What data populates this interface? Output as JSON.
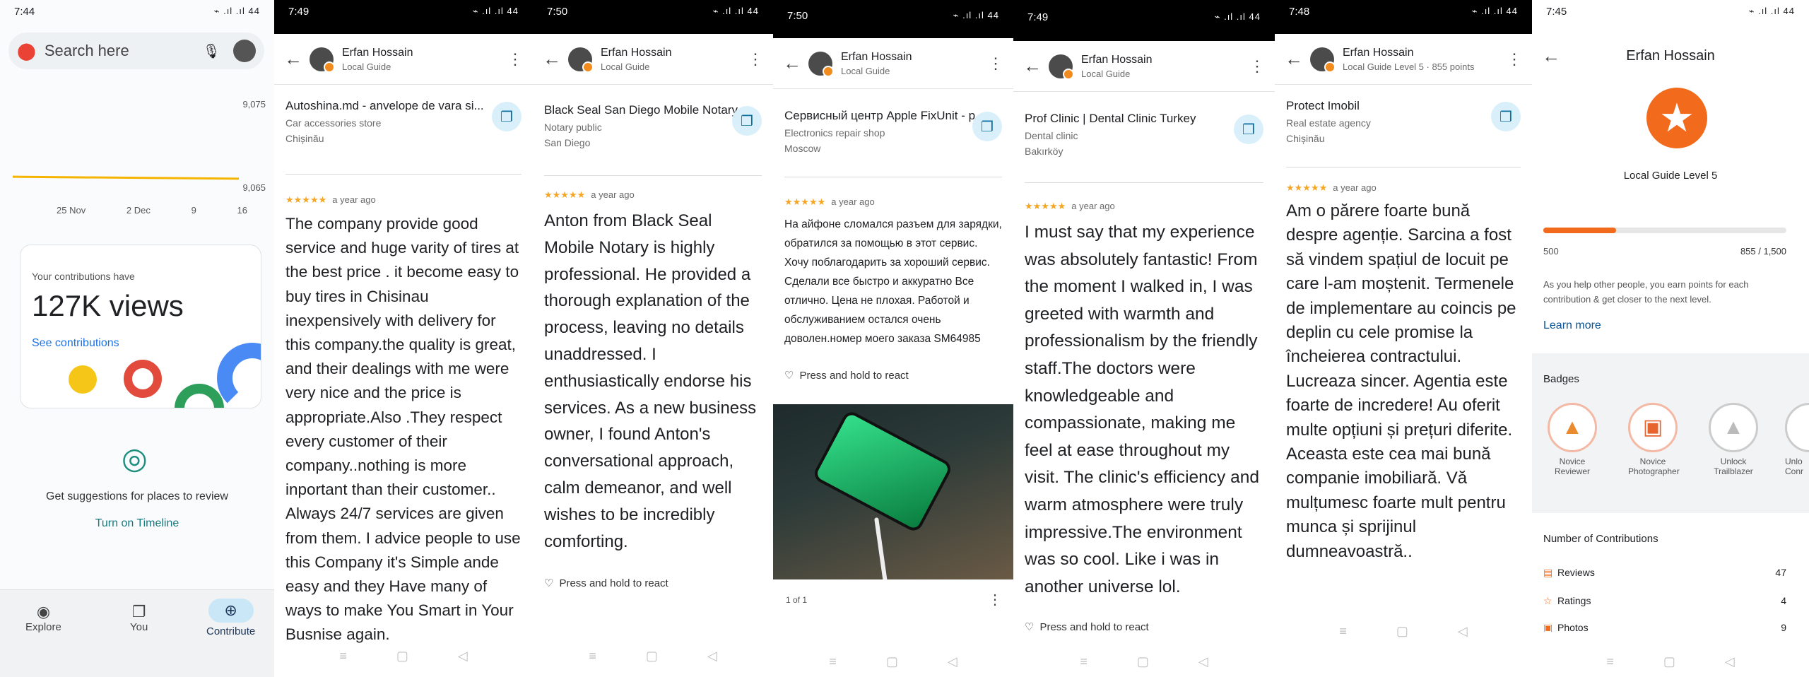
{
  "p1": {
    "time": "7:44",
    "signal": "⌁ .ıl .ıl 44",
    "search_placeholder": "Search here",
    "top_val": "9,075",
    "bottom_val": "9,065",
    "xticks": [
      "25 Nov",
      "2 Dec",
      "9",
      "16"
    ],
    "contrib_label": "Your contributions have",
    "views": "127K views",
    "see_contrib": "See contributions",
    "suggest": "Get suggestions for places to review",
    "timeline": "Turn on Timeline",
    "nav": [
      "Explore",
      "You",
      "Contribute"
    ]
  },
  "p2": {
    "time": "7:49",
    "name": "Erfan Hossain",
    "sub": "Local Guide",
    "place": "Autoshina.md - anvelope de vara si...",
    "cat": "Car accessories store",
    "city": "Chișinău",
    "ago": "a year ago",
    "review": "The company provide good service and huge varity of tires at the best price . it become easy to buy tires in Chisinau inexpensively with delivery for this company.the quality is great, and their dealings with me were very nice and the price is appropriate.Also .They respect every customer of their company..nothing is more inportant than their customer.. Always 24/7 services are given from them. I advice people to use this Company it's Simple ande easy and they Have many of ways to make You Smart in Your Busnise again."
  },
  "p3": {
    "time": "7:50",
    "name": "Erfan Hossain",
    "sub": "Local Guide",
    "place": "Black Seal San Diego Mobile Notary...",
    "cat": "Notary public",
    "city": "San Diego",
    "ago": "a year ago",
    "review": "Anton from Black Seal Mobile Notary is highly professional. He provided a thorough explanation of the process, leaving no details unaddressed. I enthusiastically endorse his services. As a new business owner, I found Anton's conversational approach, calm demeanor, and well wishes to be incredibly comforting.",
    "react": "Press and hold to react"
  },
  "p4": {
    "time": "7:50",
    "name": "Erfan Hossain",
    "sub": "Local Guide",
    "place": "Сервисный центр Apple FixUnit - р...",
    "cat": "Electronics repair shop",
    "city": "Moscow",
    "ago": "a year ago",
    "review": "На айфоне сломался разъем для зарядки, обратился за помощью в этот сервис. Хочу поблагодарить за хороший сервис. Сделали все быстро и аккуратно Все отлично. Цена не плохая. Работой и обслуживанием остался очень доволен.номер моего заказа SM64985",
    "react": "Press and hold to react",
    "counter": "1 of 1"
  },
  "p5": {
    "time": "7:49",
    "name": "Erfan Hossain",
    "sub": "Local Guide",
    "place": "Prof Clinic | Dental Clinic Turkey",
    "cat": "Dental clinic",
    "city": "Bakırköy",
    "ago": "a year ago",
    "review": "I must say that my experience was absolutely fantastic! From the moment I walked in, I was greeted with warmth and professionalism by the friendly staff.The doctors were knowledgeable and compassionate, making me feel at ease throughout my visit. The clinic's efficiency and warm atmosphere were truly impressive.The environment was so cool. Like i was in another universe lol.",
    "react": "Press and hold to react"
  },
  "p6": {
    "time": "7:48",
    "name": "Erfan Hossain",
    "sub": "Local Guide Level 5 · 855 points",
    "place": "Protect Imobil",
    "cat": "Real estate agency",
    "city": "Chișinău",
    "ago": "a year ago",
    "review": "Am o părere foarte bună despre agenție. Sarcina a fost să vindem spațiul de locuit pe care l-am moștenit. Termenele de implementare au coincis pe deplin cu cele promise la încheierea contractului. Lucreaza sincer. Agentia este foarte de incredere! Au oferit multe opțiuni și prețuri diferite. Aceasta este cea mai bună companie imobiliară. Vă mulțumesc foarte mult pentru munca și sprijinul dumneavoastră.."
  },
  "p7": {
    "time": "7:45",
    "title": "Erfan Hossain",
    "level": "Local Guide Level 5",
    "pmin": "500",
    "points": "855 / 1,500",
    "progress": 0.3,
    "help": "As you help other people, you earn points for each contribution & get closer to the next level.",
    "learn": "Learn more",
    "badges_title": "Badges",
    "badges": [
      "Novice Reviewer",
      "Novice Photographer",
      "Unlock Trailblazer",
      "Unlo Conr"
    ],
    "contrib_title": "Number of Contributions",
    "contribs": [
      {
        "label": "Reviews",
        "n": "47"
      },
      {
        "label": "Ratings",
        "n": "4"
      },
      {
        "label": "Photos",
        "n": "9"
      }
    ]
  },
  "colors": {
    "accent": "#f28b1e",
    "link": "#1a73e8",
    "star": "#f5a623"
  }
}
